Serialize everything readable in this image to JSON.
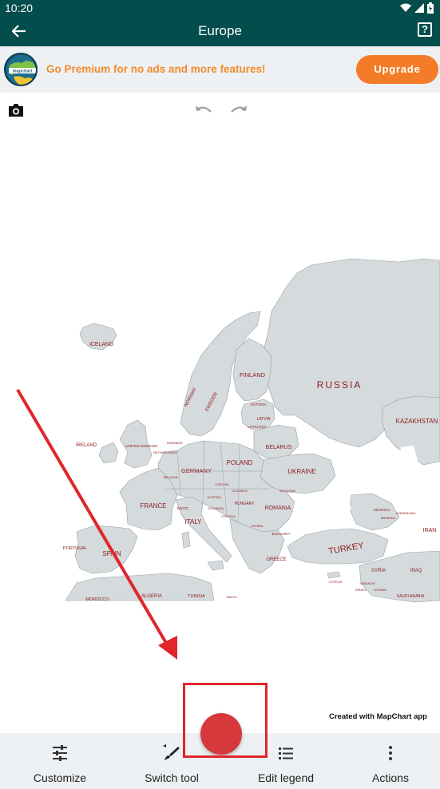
{
  "status_bar": {
    "time": "10:20"
  },
  "app_bar": {
    "title": "Europe",
    "back_icon": "arrow-back-icon",
    "help_icon": "help-icon"
  },
  "promo": {
    "text": "Go Premium for no ads and more features!",
    "button_label": "Upgrade",
    "logo_text": "mapchart"
  },
  "toolbar": {
    "camera_icon": "camera-icon",
    "undo_icon": "undo-icon",
    "redo_icon": "redo-icon"
  },
  "map": {
    "labels": {
      "iceland": "ICELAND",
      "finland": "FINLAND",
      "russia": "RUSSIA",
      "kazakhstan": "KAZAKHSTAN",
      "norway": "NORWAY",
      "sweden": "SWEDEN",
      "estonia": "ESTONIA",
      "latvia": "LATVIA",
      "lithuania": "LITHUANIA",
      "ireland": "IRELAND",
      "united_kingdom": "UNITED KINGDOM",
      "denmark": "DENMARK",
      "netherlands": "NETHERLANDS",
      "belarus": "BELARUS",
      "germany": "GERMANY",
      "poland": "POLAND",
      "belgium": "BELGIUM",
      "ukraine": "UKRAINE",
      "czechia": "CZECHIA",
      "slovakia": "SLOVAKIA",
      "moldova": "MOLDOVA",
      "france": "FRANCE",
      "austria": "AUSTRIA",
      "hungary": "HUNGARY",
      "switz": "SWITZ.",
      "romania": "ROMANIA",
      "slovenia": "SLOVENIA",
      "croatia": "CROATIA",
      "serbia": "SERBIA",
      "italy": "ITALY",
      "bulgaria": "BULGARIA",
      "georgia": "GEORGIA",
      "armenia": "ARMENIA",
      "azerbaijan": "AZERBAIJAN",
      "portugal": "PORTUGAL",
      "spain": "SPAIN",
      "turkey": "TURKEY",
      "iran": "IRAN",
      "greece": "GREECE",
      "syria": "SYRIA",
      "iraq": "IRAQ",
      "morocco": "MOROCCO",
      "algeria": "ALGERIA",
      "tunisia": "TUNISIA",
      "malta": "MALTA",
      "cyprus": "CYPRUS",
      "lebanon": "LEBANON",
      "israel": "ISRAEL",
      "jordan": "JORDAN",
      "saudi_arabia": "SAUDI ARABIA"
    },
    "land_color": "#d5dadd",
    "label_color": "#8b1a1a"
  },
  "credit": "Created with MapChart app",
  "bottom_nav": {
    "customize": "Customize",
    "switch_tool": "Switch tool",
    "edit_legend": "Edit legend",
    "actions": "Actions"
  },
  "fab": {
    "icon": "color-dot-icon",
    "color": "#d6393b"
  },
  "colors": {
    "app_bar": "#044d4d",
    "accent": "#f47c28",
    "annotation": "#e2252c"
  }
}
